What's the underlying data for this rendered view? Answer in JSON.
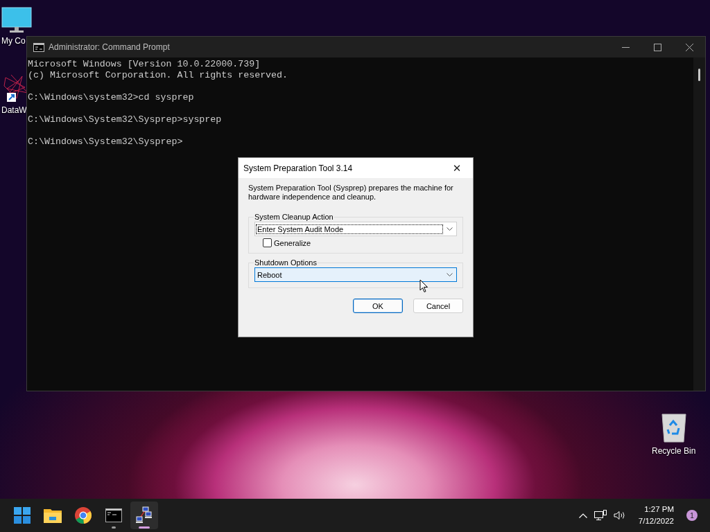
{
  "desktop_icons": [
    {
      "kind": "monitor",
      "label": "My Co"
    },
    {
      "kind": "shortcut",
      "label": "DataW"
    },
    {
      "kind": "recycle",
      "label": "Recycle Bin"
    }
  ],
  "cmd_window": {
    "title": "Administrator: Command Prompt",
    "blocks": [
      [
        "Microsoft Windows [Version 10.0.22000.739]",
        "(c) Microsoft Corporation. All rights reserved."
      ],
      [
        "C:\\Windows\\system32>cd sysprep"
      ],
      [
        "C:\\Windows\\System32\\Sysprep>sysprep"
      ],
      [
        "C:\\Windows\\System32\\Sysprep>"
      ]
    ]
  },
  "dialog": {
    "title": "System Preparation Tool 3.14",
    "close": "✕",
    "description": "System Preparation Tool (Sysprep) prepares the machine for hardware independence and cleanup.",
    "groups": [
      {
        "legend": "System Cleanup Action",
        "dropdown": {
          "value": "Enter System Audit Mode",
          "focus_rect": true,
          "hovered": false
        },
        "checkbox": {
          "label": "Generalize",
          "checked": false
        }
      },
      {
        "legend": "Shutdown Options",
        "dropdown": {
          "value": "Reboot",
          "focus_rect": false,
          "hovered": true
        }
      }
    ],
    "buttons": [
      {
        "label": "OK",
        "default": true
      },
      {
        "label": "Cancel",
        "default": false
      }
    ]
  },
  "taskbar": {
    "apps": [
      {
        "kind": "start",
        "running": false,
        "active": false
      },
      {
        "kind": "folder",
        "running": false,
        "active": false
      },
      {
        "kind": "browser",
        "running": false,
        "active": false
      },
      {
        "kind": "terminal",
        "running": true,
        "active": false
      },
      {
        "kind": "network",
        "running": true,
        "active": true
      }
    ],
    "time": "1:27 PM",
    "date": "7/12/2022",
    "notification_count": "1"
  }
}
